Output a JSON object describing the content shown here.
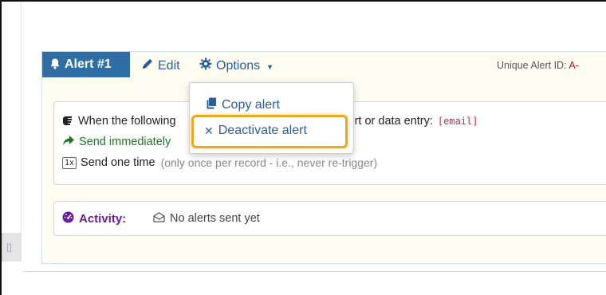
{
  "alert": {
    "title": "Alert #1",
    "edit_label": "Edit",
    "options_label": "Options",
    "uid_label": "Unique Alert ID:",
    "uid_value": "A-"
  },
  "trigger": {
    "line1_text": "When the following",
    "line1_suffix": "ing data import or data entry:",
    "line1_code": "[email]",
    "send_immediately": "Send immediately",
    "send_once_badge": "1x",
    "send_once": "Send one time",
    "send_once_note": "(only once per record - i.e., never re-trigger)"
  },
  "activity": {
    "label": "Activity:",
    "value": "No alerts sent yet"
  },
  "options_menu": {
    "items": [
      {
        "label": "Copy alert",
        "icon": "copy-icon"
      },
      {
        "label": "Deactivate alert",
        "icon": "x-icon"
      }
    ]
  },
  "colors": {
    "title_bg": "#2e6ea5",
    "link": "#2c5f98",
    "highlight": "#e9a923",
    "activity": "#6a1b9a",
    "green": "#1e7a1e"
  }
}
